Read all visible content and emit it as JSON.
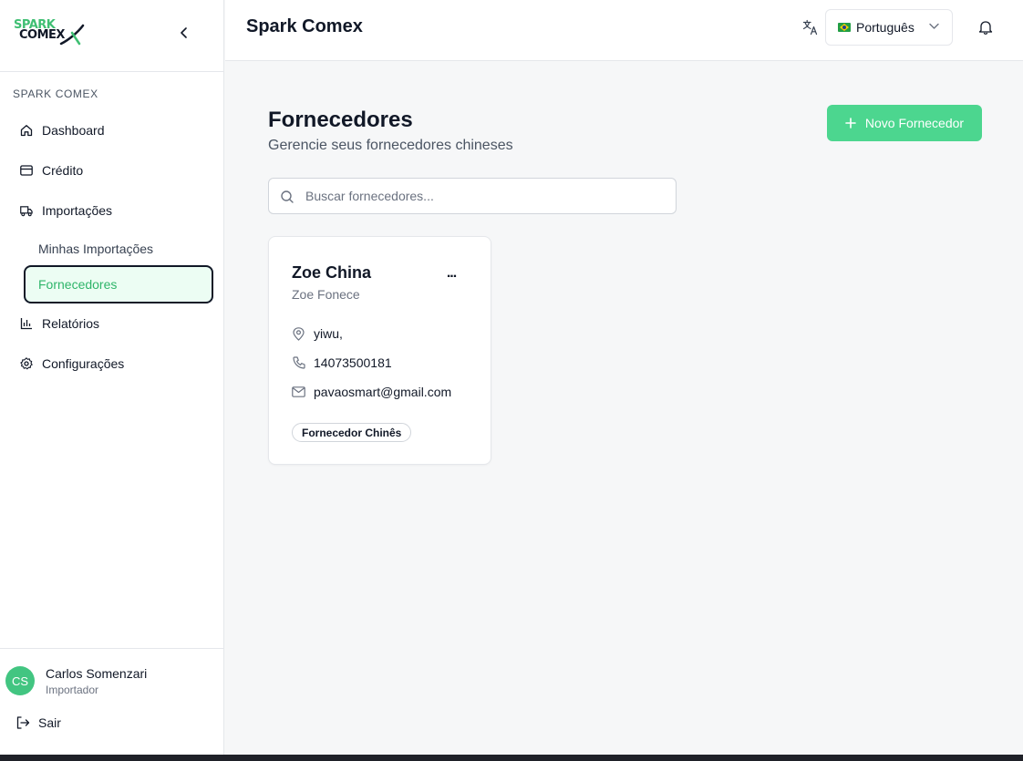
{
  "colors": {
    "accent": "#4cd68f",
    "active_text": "#2fb56a",
    "active_bg": "#ecfdf3"
  },
  "brand": {
    "logo_line1": "SPARK",
    "logo_line2": "COMEX",
    "app_name": "Spark Comex"
  },
  "sidebar": {
    "section_label": "SPARK COMEX",
    "items": [
      {
        "label": "Dashboard",
        "icon": "home-icon"
      },
      {
        "label": "Crédito",
        "icon": "credit-card-icon"
      },
      {
        "label": "Importações",
        "icon": "truck-icon"
      },
      {
        "label": "Minhas Importações"
      },
      {
        "label": "Fornecedores",
        "active": true
      },
      {
        "label": "Relatórios",
        "icon": "bar-chart-icon"
      },
      {
        "label": "Configurações",
        "icon": "gear-icon"
      }
    ],
    "user": {
      "initials": "CS",
      "name": "Carlos Somenzari",
      "role": "Importador"
    },
    "logout_label": "Sair"
  },
  "header": {
    "title": "Spark Comex",
    "language": {
      "selected": "Português",
      "flag": "brazil-flag-icon"
    }
  },
  "main": {
    "title": "Fornecedores",
    "subtitle": "Gerencie seus fornecedores chineses",
    "new_button_label": "Novo Fornecedor",
    "search_placeholder": "Buscar fornecedores...",
    "suppliers": [
      {
        "name": "Zoe China",
        "contact": "Zoe Fonece",
        "location": "yiwu,",
        "phone": "14073500181",
        "email": "pavaosmart@gmail.com",
        "badge": "Fornecedor Chinês",
        "menu_label": "..."
      }
    ]
  }
}
